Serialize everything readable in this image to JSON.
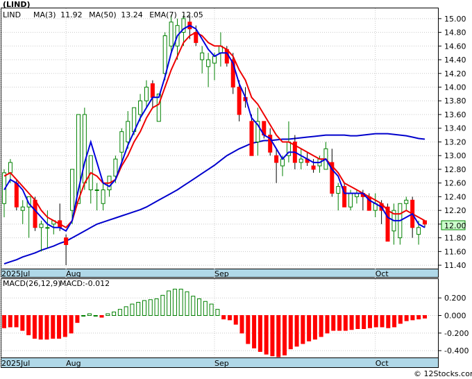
{
  "header": {
    "ticker": "(LIND)",
    "legend": [
      {
        "label": "MA(3)",
        "value": "11.92",
        "color": "#000000"
      },
      {
        "label": "MA(50)",
        "value": "13.24",
        "color": "#0000cc"
      },
      {
        "label": "EMA(7)",
        "value": "12.05",
        "color": "#0000cc"
      }
    ]
  },
  "price_badge": "12.00",
  "macd_legend": {
    "name": "MACD(26,12,9)",
    "value_label": "MACD:-0.012"
  },
  "date_labels": [
    "2025Jul",
    "Aug",
    "Sep",
    "Oct"
  ],
  "watermark": "© 12Stocks.com",
  "colors": {
    "up": "#008000",
    "down": "#ff0000",
    "ma_fast": "#0000dd",
    "ma_slow": "#0000cc",
    "ema": "#ee0000",
    "axis_band": "#b0d8e8"
  },
  "chart_data": [
    {
      "type": "candlestick",
      "title": "(LIND)",
      "ylim": [
        11.35,
        15.12
      ],
      "yticks": [
        "15.00",
        "14.80",
        "14.60",
        "14.40",
        "14.20",
        "14.00",
        "13.80",
        "13.60",
        "13.40",
        "13.20",
        "13.00",
        "12.80",
        "12.60",
        "12.40",
        "12.20",
        "12.00",
        "11.80",
        "11.60",
        "11.40"
      ],
      "ohlc": [
        [
          12.3,
          12.8,
          12.1,
          12.75
        ],
        [
          12.75,
          12.95,
          12.6,
          12.9
        ],
        [
          12.6,
          12.65,
          12.2,
          12.25
        ],
        [
          12.2,
          12.35,
          12.0,
          12.25
        ],
        [
          12.25,
          12.4,
          11.8,
          12.4
        ],
        [
          12.35,
          12.4,
          11.9,
          11.95
        ],
        [
          11.95,
          12.05,
          11.6,
          12.0
        ],
        [
          11.95,
          12.2,
          11.65,
          11.95
        ],
        [
          12.0,
          12.05,
          11.85,
          12.05
        ],
        [
          12.05,
          12.3,
          11.9,
          11.95
        ],
        [
          11.8,
          11.85,
          11.4,
          11.7
        ],
        [
          12.2,
          12.6,
          12.0,
          12.8
        ],
        [
          12.3,
          13.0,
          12.4,
          13.6
        ],
        [
          12.6,
          13.7,
          12.5,
          13.6
        ],
        [
          12.5,
          13.0,
          12.3,
          13.0
        ],
        [
          12.5,
          12.6,
          12.2,
          12.5
        ],
        [
          12.3,
          12.6,
          12.2,
          12.5
        ],
        [
          12.5,
          12.7,
          12.4,
          12.7
        ],
        [
          12.7,
          13.0,
          12.6,
          12.95
        ],
        [
          13.05,
          13.4,
          12.9,
          13.35
        ],
        [
          13.2,
          13.65,
          13.1,
          13.5
        ],
        [
          13.35,
          13.7,
          13.3,
          13.7
        ],
        [
          13.6,
          13.9,
          13.5,
          13.8
        ],
        [
          13.8,
          14.1,
          13.7,
          14.0
        ],
        [
          14.05,
          14.1,
          13.7,
          13.85
        ],
        [
          13.5,
          13.9,
          13.5,
          13.9
        ],
        [
          14.2,
          14.8,
          14.1,
          14.75
        ],
        [
          14.6,
          15.05,
          14.5,
          14.95
        ],
        [
          14.6,
          15.0,
          14.4,
          14.9
        ],
        [
          14.8,
          15.05,
          14.6,
          15.0
        ],
        [
          14.95,
          15.05,
          14.7,
          14.85
        ],
        [
          14.8,
          14.9,
          14.6,
          14.65
        ],
        [
          14.4,
          14.6,
          14.2,
          14.5
        ],
        [
          14.3,
          14.5,
          14.0,
          14.4
        ],
        [
          14.35,
          14.5,
          14.1,
          14.45
        ],
        [
          14.5,
          14.8,
          14.3,
          14.6
        ],
        [
          14.55,
          14.6,
          14.3,
          14.35
        ],
        [
          14.4,
          14.5,
          13.9,
          14.0
        ],
        [
          14.0,
          14.1,
          13.5,
          13.6
        ],
        [
          13.85,
          14.0,
          13.7,
          13.8
        ],
        [
          13.5,
          13.6,
          13.0,
          13.0
        ],
        [
          13.2,
          13.7,
          13.0,
          13.5
        ],
        [
          13.5,
          13.5,
          13.25,
          13.3
        ],
        [
          13.3,
          13.4,
          13.0,
          13.05
        ],
        [
          13.0,
          13.1,
          12.6,
          12.9
        ],
        [
          12.85,
          13.0,
          12.7,
          12.95
        ],
        [
          13.0,
          13.5,
          12.9,
          13.2
        ],
        [
          13.2,
          13.3,
          12.8,
          12.9
        ],
        [
          12.9,
          13.1,
          12.8,
          12.95
        ],
        [
          12.95,
          13.05,
          12.85,
          12.9
        ],
        [
          12.85,
          12.95,
          12.75,
          12.8
        ],
        [
          12.85,
          13.0,
          12.75,
          12.95
        ],
        [
          12.8,
          13.2,
          12.9,
          13.1
        ],
        [
          12.9,
          13.1,
          12.4,
          12.45
        ],
        [
          12.45,
          12.6,
          12.2,
          12.55
        ],
        [
          12.55,
          12.6,
          12.3,
          12.25
        ],
        [
          12.25,
          12.5,
          12.2,
          12.45
        ],
        [
          12.4,
          12.5,
          12.3,
          12.45
        ],
        [
          12.45,
          12.5,
          12.2,
          12.4
        ],
        [
          12.4,
          12.45,
          12.2,
          12.2
        ],
        [
          12.2,
          12.45,
          12.1,
          12.3
        ],
        [
          12.3,
          12.35,
          12.0,
          12.2
        ],
        [
          12.25,
          12.3,
          11.75,
          11.75
        ],
        [
          11.9,
          12.3,
          11.7,
          12.2
        ],
        [
          11.8,
          12.3,
          11.7,
          12.3
        ],
        [
          12.3,
          12.4,
          12.2,
          12.35
        ],
        [
          12.35,
          12.4,
          11.8,
          11.95
        ],
        [
          11.85,
          12.05,
          11.7,
          11.95
        ],
        [
          12.05,
          12.05,
          11.95,
          12.0
        ]
      ],
      "ma3": [
        12.5,
        12.65,
        12.6,
        12.5,
        12.3,
        12.2,
        12.1,
        12.0,
        11.95,
        11.95,
        11.9,
        12.05,
        12.5,
        12.9,
        13.2,
        12.9,
        12.6,
        12.55,
        12.65,
        12.9,
        13.15,
        13.35,
        13.55,
        13.7,
        13.85,
        13.85,
        14.15,
        14.5,
        14.75,
        14.85,
        14.9,
        14.85,
        14.7,
        14.55,
        14.45,
        14.5,
        14.5,
        14.35,
        14.05,
        13.85,
        13.55,
        13.45,
        13.3,
        13.25,
        13.1,
        12.95,
        13.05,
        13.05,
        13.0,
        12.95,
        12.9,
        12.9,
        12.95,
        12.8,
        12.7,
        12.45,
        12.45,
        12.45,
        12.45,
        12.35,
        12.3,
        12.25,
        12.1,
        12.05,
        12.05,
        12.1,
        12.15,
        12.0,
        11.95
      ],
      "ema7": [
        12.7,
        12.75,
        12.65,
        12.55,
        12.45,
        12.35,
        12.2,
        12.1,
        12.05,
        12.0,
        11.95,
        12.05,
        12.35,
        12.6,
        12.75,
        12.7,
        12.6,
        12.6,
        12.65,
        12.85,
        13.0,
        13.2,
        13.35,
        13.55,
        13.7,
        13.75,
        14.0,
        14.25,
        14.45,
        14.65,
        14.75,
        14.8,
        14.75,
        14.65,
        14.6,
        14.6,
        14.55,
        14.45,
        14.25,
        14.1,
        13.85,
        13.75,
        13.6,
        13.45,
        13.3,
        13.2,
        13.2,
        13.15,
        13.1,
        13.05,
        13.0,
        12.95,
        12.95,
        12.85,
        12.75,
        12.6,
        12.55,
        12.5,
        12.45,
        12.4,
        12.35,
        12.3,
        12.2,
        12.15,
        12.15,
        12.2,
        12.15,
        12.1,
        12.05
      ],
      "ma50": [
        11.42,
        11.45,
        11.48,
        11.52,
        11.55,
        11.58,
        11.62,
        11.65,
        11.68,
        11.72,
        11.75,
        11.8,
        11.85,
        11.9,
        11.95,
        12.0,
        12.03,
        12.06,
        12.09,
        12.12,
        12.15,
        12.18,
        12.21,
        12.25,
        12.3,
        12.35,
        12.4,
        12.45,
        12.5,
        12.56,
        12.62,
        12.68,
        12.74,
        12.8,
        12.86,
        12.93,
        13.0,
        13.05,
        13.1,
        13.14,
        13.18,
        13.2,
        13.22,
        13.22,
        13.23,
        13.24,
        13.24,
        13.25,
        13.26,
        13.27,
        13.28,
        13.29,
        13.3,
        13.3,
        13.3,
        13.3,
        13.29,
        13.29,
        13.3,
        13.31,
        13.32,
        13.32,
        13.32,
        13.31,
        13.3,
        13.29,
        13.27,
        13.25,
        13.24
      ]
    },
    {
      "type": "bar",
      "title": "MACD(26,12,9)",
      "ylim": [
        -0.47,
        0.32
      ],
      "yticks": [
        "0.200",
        "0.000",
        "-0.200",
        "-0.400"
      ],
      "values": [
        -0.14,
        -0.13,
        -0.13,
        -0.17,
        -0.22,
        -0.26,
        -0.27,
        -0.27,
        -0.26,
        -0.26,
        -0.24,
        -0.2,
        -0.08,
        0.0,
        0.02,
        0.0,
        -0.02,
        0.02,
        0.04,
        0.07,
        0.1,
        0.13,
        0.15,
        0.17,
        0.18,
        0.19,
        0.23,
        0.28,
        0.3,
        0.3,
        0.27,
        0.22,
        0.19,
        0.16,
        0.13,
        0.07,
        -0.04,
        -0.05,
        -0.1,
        -0.2,
        -0.32,
        -0.37,
        -0.41,
        -0.44,
        -0.46,
        -0.47,
        -0.45,
        -0.38,
        -0.35,
        -0.32,
        -0.29,
        -0.27,
        -0.24,
        -0.2,
        -0.17,
        -0.17,
        -0.17,
        -0.16,
        -0.15,
        -0.15,
        -0.14,
        -0.13,
        -0.13,
        -0.14,
        -0.13,
        -0.09,
        -0.06,
        -0.05,
        -0.04,
        -0.03
      ]
    }
  ]
}
